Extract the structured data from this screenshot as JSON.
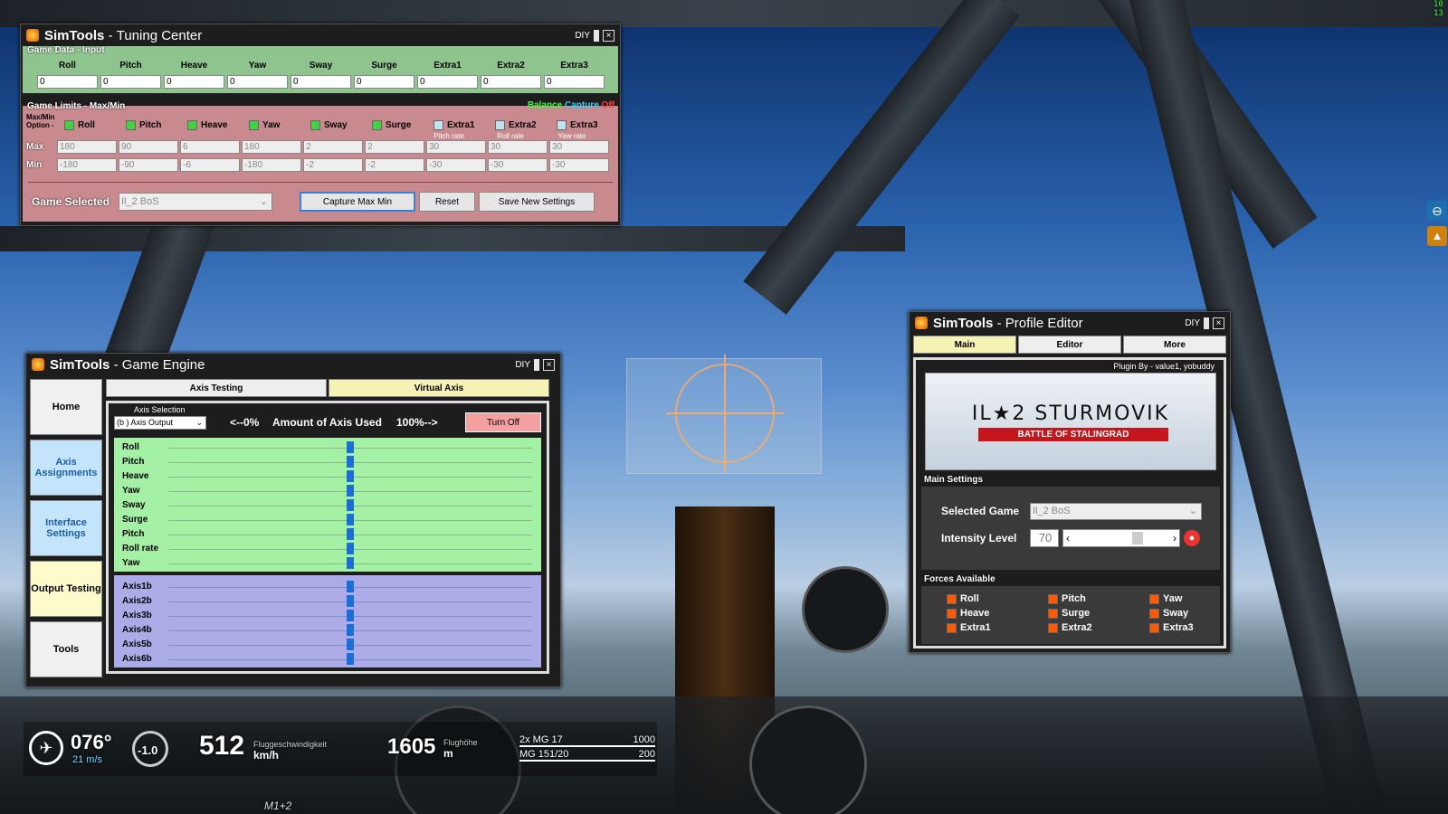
{
  "corner_readout": [
    "10",
    "13"
  ],
  "tuning": {
    "app": "SimTools",
    "title_rest": "Tuning Center",
    "diy": "DIY",
    "close": "×",
    "input_section": "Game Data - Input",
    "axes": [
      "Roll",
      "Pitch",
      "Heave",
      "Yaw",
      "Sway",
      "Surge",
      "Extra1",
      "Extra2",
      "Extra3"
    ],
    "inputs": [
      "0",
      "0",
      "0",
      "0",
      "0",
      "0",
      "0",
      "0",
      "0"
    ],
    "limits_section": "Game Limits - Max/Min",
    "balance": "Balance",
    "capture": "Capture",
    "off": "Off",
    "option_label": "Max/Min Option -",
    "sublabels": [
      "",
      "",
      "",
      "",
      "",
      "",
      "Pitch rate",
      "Roll rate",
      "Yaw rate"
    ],
    "max_label": "Max",
    "min_label": "Min",
    "max": [
      "180",
      "90",
      "6",
      "180",
      "2",
      "2",
      "30",
      "30",
      "30"
    ],
    "min": [
      "-180",
      "-90",
      "-6",
      "-180",
      "-2",
      "-2",
      "-30",
      "-30",
      "-30"
    ],
    "game_selected_label": "Game Selected",
    "game_selected": "Il_2 BoS",
    "capture_btn": "Capture Max Min",
    "reset_btn": "Reset",
    "save_btn": "Save New Settings"
  },
  "engine": {
    "app": "SimTools",
    "title_rest": "Game Engine",
    "diy": "DIY",
    "close": "×",
    "nav": [
      "Home",
      "Axis Assignments",
      "Interface Settings",
      "Output Testing",
      "Tools"
    ],
    "tabs": [
      "Axis Testing",
      "Virtual Axis"
    ],
    "axis_selection_label": "Axis Selection",
    "axis_selection": "(b ) Axis Output",
    "left": "<--0%",
    "center": "Amount of Axis Used",
    "right": "100%-->",
    "turn_off": "Turn Off",
    "green_axes": [
      "Roll",
      "Pitch",
      "Heave",
      "Yaw",
      "Sway",
      "Surge",
      "Pitch",
      "Roll rate",
      "Yaw"
    ],
    "blue_axes": [
      "Axis1b",
      "Axis2b",
      "Axis3b",
      "Axis4b",
      "Axis5b",
      "Axis6b"
    ],
    "slider_fraction": 0.5
  },
  "profile": {
    "app": "SimTools",
    "title_rest": "Profile Editor",
    "diy": "DIY",
    "close": "×",
    "tabs": [
      "Main",
      "Editor",
      "More"
    ],
    "plugin_by": "Plugin By - value1, yobuddy",
    "logo_main": "IL★2 STURMOVIK",
    "logo_sub": "BATTLE OF STALINGRAD",
    "main_settings": "Main Settings",
    "selected_game_label": "Selected Game",
    "selected_game": "Il_2 BoS",
    "intensity_label": "Intensity Level",
    "intensity": "70",
    "intensity_fraction": 0.7,
    "forces_label": "Forces Available",
    "forces": [
      "Roll",
      "Pitch",
      "Yaw",
      "Heave",
      "Surge",
      "Sway",
      "Extra1",
      "Extra2",
      "Extra3"
    ]
  },
  "hud": {
    "heading": "076°",
    "wind": "21 m/s",
    "vario": "-1.0",
    "speed": "512",
    "speed_label": "Fluggeschwindigkeit",
    "speed_unit": "km/h",
    "altitude": "1605",
    "alt_label": "Flughöhe",
    "alt_unit": "m",
    "weapons": [
      {
        "name": "2x MG 17",
        "ammo": "1000"
      },
      {
        "name": "MG 151/20",
        "ammo": "200"
      }
    ],
    "plane": "M1+2"
  },
  "colors": {
    "accent_orange": "#ff5a00",
    "green_panel": "#8ec58e",
    "red_panel": "#c98a8f",
    "lavender": "#ababe8",
    "balance_green": "#39ff39"
  }
}
